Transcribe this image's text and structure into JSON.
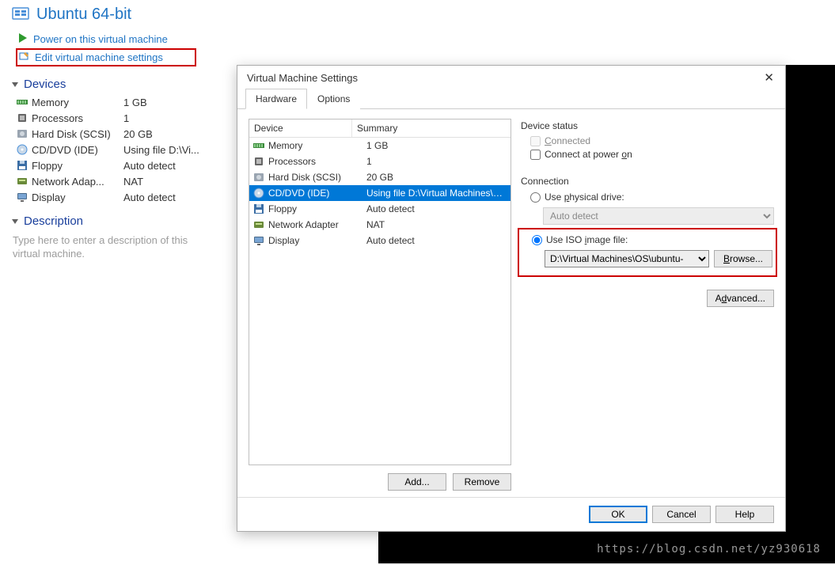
{
  "vm_title": "Ubuntu 64-bit",
  "actions": {
    "power_on": "Power on this virtual machine",
    "edit_settings": "Edit virtual machine settings"
  },
  "sections": {
    "devices_title": "Devices",
    "description_title": "Description"
  },
  "left_devices": [
    {
      "icon": "memory",
      "name": "Memory",
      "summary": "1 GB"
    },
    {
      "icon": "cpu",
      "name": "Processors",
      "summary": "1"
    },
    {
      "icon": "hdd",
      "name": "Hard Disk (SCSI)",
      "summary": "20 GB"
    },
    {
      "icon": "cd",
      "name": "CD/DVD (IDE)",
      "summary": "Using file D:\\Vi..."
    },
    {
      "icon": "floppy",
      "name": "Floppy",
      "summary": "Auto detect"
    },
    {
      "icon": "net",
      "name": "Network Adap...",
      "summary": "NAT"
    },
    {
      "icon": "display",
      "name": "Display",
      "summary": "Auto detect"
    }
  ],
  "description_placeholder": "Type here to enter a description of this virtual machine.",
  "dialog": {
    "title": "Virtual Machine Settings",
    "tabs": {
      "hardware": "Hardware",
      "options": "Options"
    },
    "columns": {
      "device": "Device",
      "summary": "Summary"
    },
    "devices": [
      {
        "icon": "memory",
        "name": "Memory",
        "summary": "1 GB",
        "selected": false
      },
      {
        "icon": "cpu",
        "name": "Processors",
        "summary": "1",
        "selected": false
      },
      {
        "icon": "hdd",
        "name": "Hard Disk (SCSI)",
        "summary": "20 GB",
        "selected": false
      },
      {
        "icon": "cd",
        "name": "CD/DVD (IDE)",
        "summary": "Using file D:\\Virtual Machines\\OS\\...",
        "selected": true
      },
      {
        "icon": "floppy",
        "name": "Floppy",
        "summary": "Auto detect",
        "selected": false
      },
      {
        "icon": "net",
        "name": "Network Adapter",
        "summary": "NAT",
        "selected": false
      },
      {
        "icon": "display",
        "name": "Display",
        "summary": "Auto detect",
        "selected": false
      }
    ],
    "add_label": "Add...",
    "remove_label": "Remove",
    "device_status_title": "Device status",
    "connected_label": "Connected",
    "connect_poweron_label": "Connect at power on",
    "connection_title": "Connection",
    "use_physical_label": "Use physical drive:",
    "physical_value": "Auto detect",
    "use_iso_label": "Use ISO image file:",
    "iso_value": "D:\\Virtual Machines\\OS\\ubuntu-",
    "browse_label": "Browse...",
    "advanced_label": "Advanced...",
    "ok_label": "OK",
    "cancel_label": "Cancel",
    "help_label": "Help"
  },
  "watermark": "https://blog.csdn.net/yz930618"
}
